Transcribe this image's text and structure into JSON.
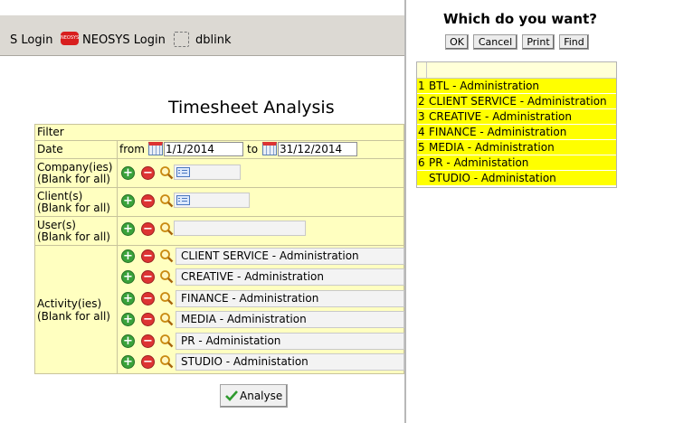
{
  "bookmarks": {
    "items": [
      {
        "label": "S Login"
      },
      {
        "label": "NEOSYS Login",
        "icon": "neosys-logo-icon",
        "icon_text": "NEOSYS"
      },
      {
        "label": "dblink",
        "icon": "blank-page-icon"
      }
    ]
  },
  "page": {
    "title": "Timesheet Analysis",
    "filter": {
      "header": "Filter",
      "date": {
        "label": "Date",
        "from_label": "from",
        "from_value": "1/1/2014",
        "to_label": "to",
        "to_value": "31/12/2014"
      },
      "companies": {
        "label_line1": "Company(ies)",
        "label_line2": "(Blank for all)"
      },
      "clients": {
        "label_line1": "Client(s)",
        "label_line2": "(Blank for all)"
      },
      "users": {
        "label_line1": "User(s)",
        "label_line2": "(Blank for all)"
      },
      "activities": {
        "label_line1": "Activity(ies)",
        "label_line2": "(Blank for all)",
        "values": [
          "CLIENT SERVICE - Administration",
          "CREATIVE - Administration",
          "FINANCE - Administration",
          "MEDIA - Administration",
          "PR - Administation",
          "STUDIO - Administation"
        ]
      },
      "add_symbol": "+",
      "remove_symbol": "−"
    },
    "analyse_button": "Analyse"
  },
  "dialog": {
    "question": "Which do you want?",
    "buttons": {
      "ok": "OK",
      "cancel": "Cancel",
      "print": "Print",
      "find": "Find"
    },
    "choices": [
      {
        "num": "1",
        "label": "BTL - Administration"
      },
      {
        "num": "2",
        "label": "CLIENT SERVICE - Administration"
      },
      {
        "num": "3",
        "label": "CREATIVE - Administration"
      },
      {
        "num": "4",
        "label": "FINANCE - Administration"
      },
      {
        "num": "5",
        "label": "MEDIA - Administration"
      },
      {
        "num": "6",
        "label": "PR - Administation"
      },
      {
        "num": "",
        "label": "STUDIO - Administation"
      }
    ],
    "highlight_color": "#ffff00"
  }
}
